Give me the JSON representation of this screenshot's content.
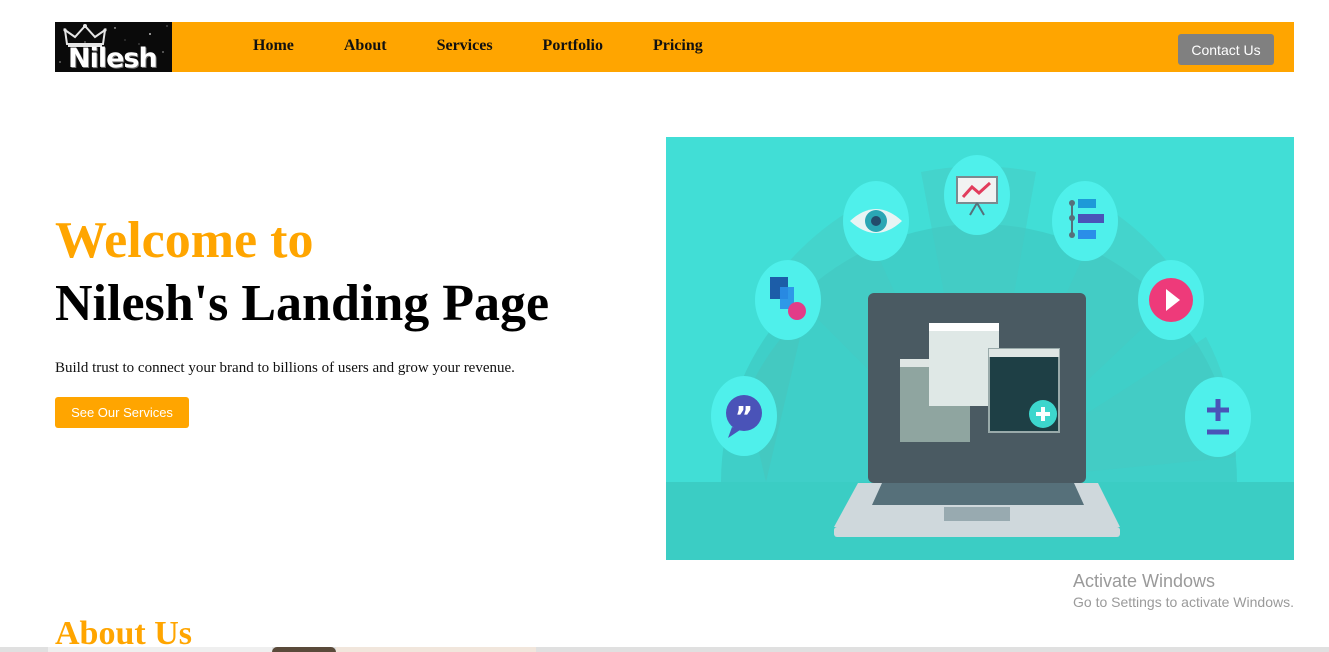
{
  "brand": {
    "logo_text": "Nilesh"
  },
  "nav": {
    "items": [
      {
        "label": "Home"
      },
      {
        "label": "About"
      },
      {
        "label": "Services"
      },
      {
        "label": "Portfolio"
      },
      {
        "label": "Pricing"
      }
    ],
    "contact_label": "Contact Us"
  },
  "hero": {
    "welcome": "Welcome to",
    "title": "Nilesh's Landing Page",
    "description": "Build trust to connect your brand to billions of users and grow your revenue.",
    "cta_label": "See Our Services",
    "illustration_icons": [
      "quote-icon",
      "layers-icon",
      "eye-icon",
      "presentation-chart-icon",
      "hierarchy-icon",
      "play-icon",
      "plus-minus-icon"
    ]
  },
  "about": {
    "heading": "About Us"
  },
  "watermark": {
    "line1": "Activate Windows",
    "line2": "Go to Settings to activate Windows."
  },
  "colors": {
    "accent": "#ffa500",
    "teal": "#41ded6",
    "contact_button": "#808080"
  }
}
